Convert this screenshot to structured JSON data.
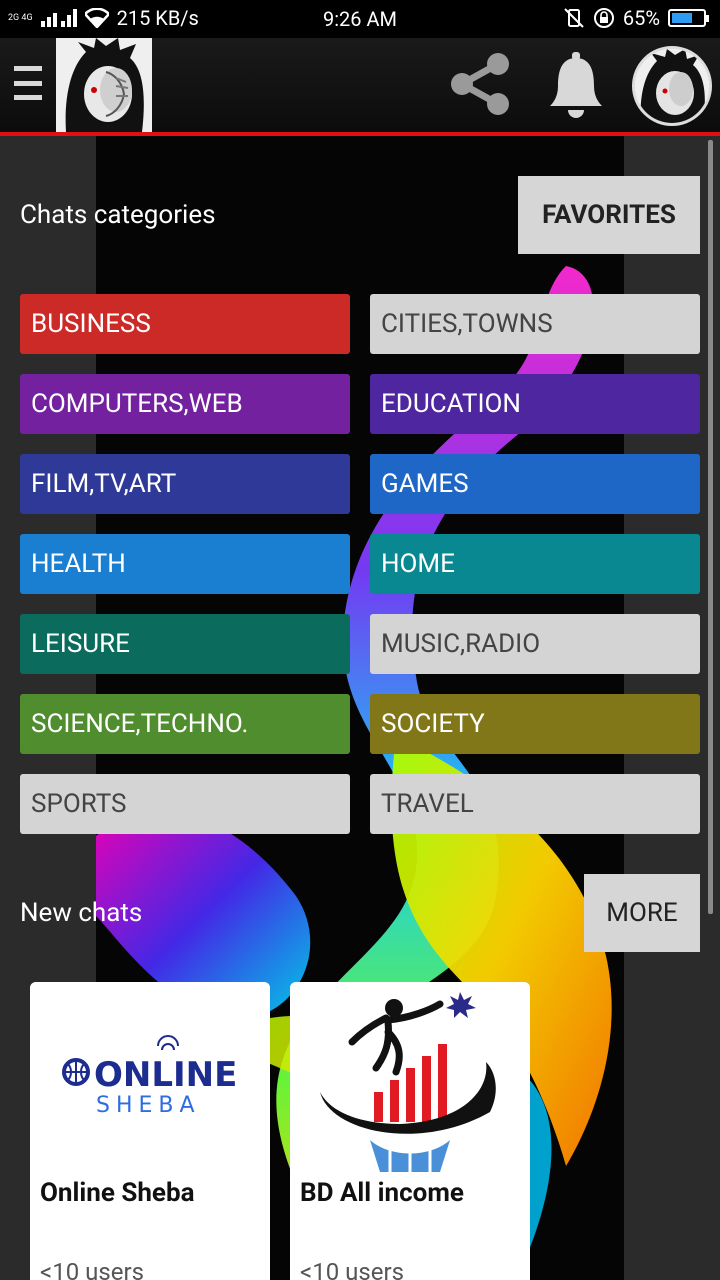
{
  "status_bar": {
    "network_label": "2G 4G",
    "speed": "215 KB/s",
    "time": "9:26 AM",
    "battery_percent": "65%",
    "battery_level": 0.65
  },
  "app_bar": {
    "menu_icon": "hamburger-icon",
    "share_icon": "share-icon",
    "bell_icon": "bell-icon"
  },
  "categories_section": {
    "title": "Chats categories",
    "favorites_label": "FAVORITES",
    "items": [
      {
        "label": "BUSINESS",
        "color": "#cc2a27"
      },
      {
        "label": "CITIES,TOWNS",
        "color": "#d4d4d4"
      },
      {
        "label": "COMPUTERS,WEB",
        "color": "#7421a0"
      },
      {
        "label": "EDUCATION",
        "color": "#4e27a0"
      },
      {
        "label": "FILM,TV,ART",
        "color": "#2f3a98"
      },
      {
        "label": "GAMES",
        "color": "#1f67c7"
      },
      {
        "label": "HEALTH",
        "color": "#1a7fd0"
      },
      {
        "label": "HOME",
        "color": "#098892"
      },
      {
        "label": "LEISURE",
        "color": "#0b6c5e"
      },
      {
        "label": "MUSIC,RADIO",
        "color": "#d4d4d4"
      },
      {
        "label": "SCIENCE,TECHNO.",
        "color": "#4f8d2e"
      },
      {
        "label": "SOCIETY",
        "color": "#827718"
      },
      {
        "label": "SPORTS",
        "color": "#d4d4d4"
      },
      {
        "label": "TRAVEL",
        "color": "#d4d4d4"
      }
    ]
  },
  "new_chats": {
    "title": "New chats",
    "more_label": "MORE",
    "cards": [
      {
        "name": "Online Sheba",
        "users": "<10 users",
        "logo_line1": "ONLINE",
        "logo_line2": "SHEBA"
      },
      {
        "name": "BD All income",
        "users": "<10 users"
      }
    ]
  }
}
